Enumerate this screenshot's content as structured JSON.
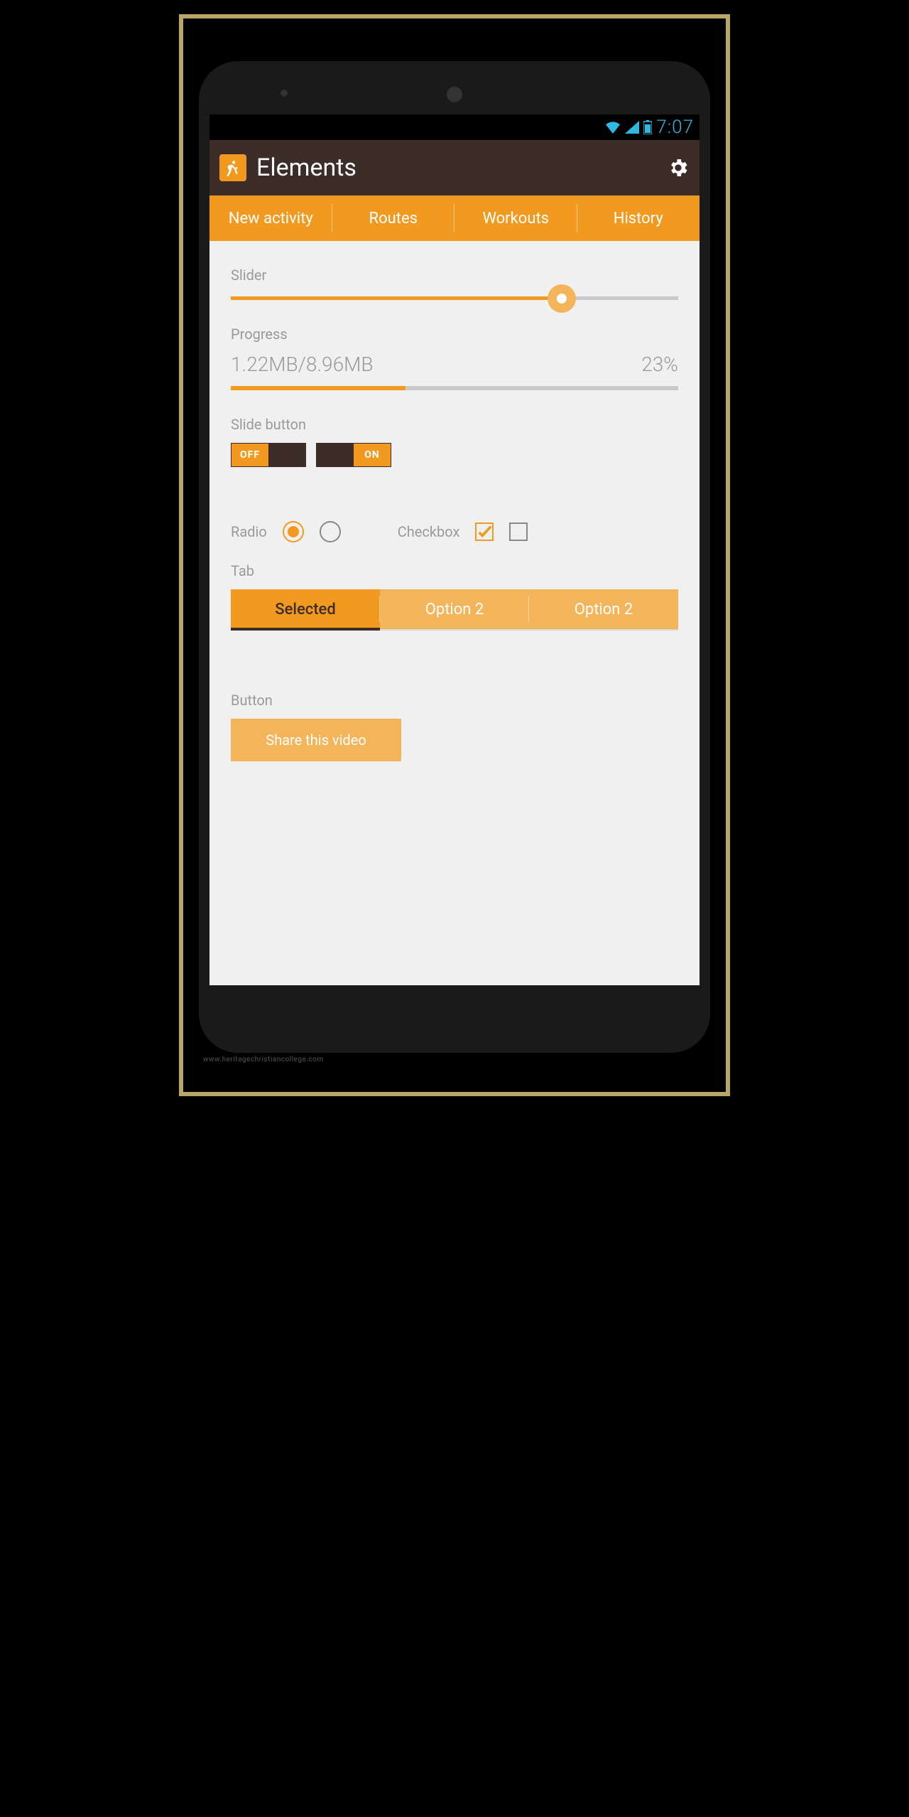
{
  "statusbar": {
    "time": "7:07"
  },
  "appbar": {
    "title": "Elements"
  },
  "topnav": {
    "items": [
      "New activity",
      "Routes",
      "Workouts",
      "History"
    ]
  },
  "slider": {
    "label": "Slider",
    "percent": 74
  },
  "progress": {
    "label": "Progress",
    "text": "1.22MB/8.96MB",
    "percent_label": "23%",
    "percent": 39
  },
  "slidebutton": {
    "label": "Slide button",
    "off_label": "OFF",
    "on_label": "ON"
  },
  "radio": {
    "label": "Radio"
  },
  "checkbox": {
    "label": "Checkbox"
  },
  "tabs": {
    "label": "Tab",
    "items": [
      "Selected",
      "Option 2",
      "Option 2"
    ],
    "selected_index": 0
  },
  "button": {
    "label": "Button",
    "text": "Share this video"
  },
  "watermark": "www.heritagechristiancollege.com",
  "colors": {
    "accent": "#f29a1f",
    "accent_light": "#f4b45a",
    "dark": "#3c2d29",
    "status_blue": "#2fb9e0"
  }
}
